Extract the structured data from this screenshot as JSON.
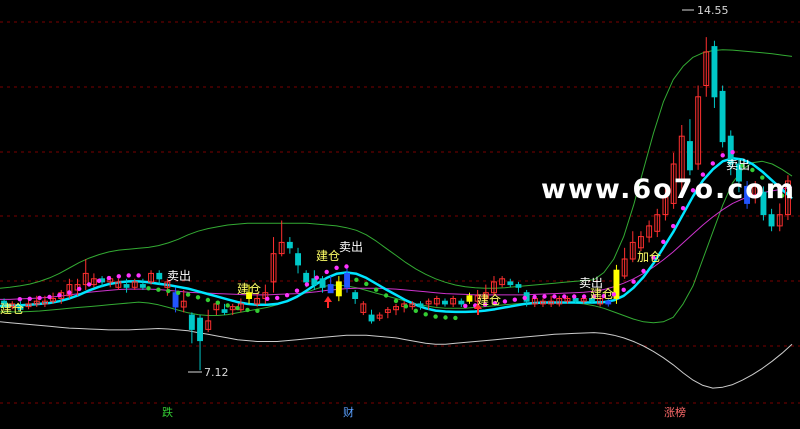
{
  "chart_data": {
    "type": "candlestick",
    "title": "",
    "ylim": [
      6.5,
      15.2
    ],
    "grid": true,
    "price_high_label": "14.55",
    "price_low_label": "7.12",
    "bottom_tags": [
      {
        "text": "跌",
        "color": "#33cc33"
      },
      {
        "text": "财",
        "color": "#5aa0ff"
      },
      {
        "text": "涨榜",
        "color": "#ff6a6a"
      }
    ],
    "signal_labels": [
      {
        "text": "建仓",
        "color": "#ffff66"
      },
      {
        "text": "卖出",
        "color": "#ffffff"
      },
      {
        "text": "建仓",
        "color": "#ffff66"
      },
      {
        "text": "建仓",
        "color": "#ffff66"
      },
      {
        "text": "卖出",
        "color": "#ffffff"
      },
      {
        "text": "建仓",
        "color": "#ffff66"
      },
      {
        "text": "卖出",
        "color": "#ffffff"
      },
      {
        "text": "建仓",
        "color": "#ffff66"
      },
      {
        "text": "加仓",
        "color": "#ffff66"
      },
      {
        "text": "卖出",
        "color": "#ffffff"
      }
    ],
    "watermark": "www.6o7o.com",
    "colors": {
      "up": "#ff3030",
      "down": "#00c8c8",
      "flat": "#ffffff",
      "highlight_up": "#ffff00",
      "highlight_down": "#2255ff",
      "main_line": "#00e5ff",
      "envelope": "#33aa33",
      "lower_band": "#cccccc",
      "ma_line": "#cc33cc",
      "dot_hold": "#ff33ff",
      "dot_wait": "#33cc33"
    },
    "candles": [
      {
        "o": 8.66,
        "c": 8.6,
        "h": 8.72,
        "l": 8.53
      },
      {
        "o": 8.54,
        "c": 8.6,
        "h": 8.66,
        "l": 8.48
      },
      {
        "o": 8.54,
        "c": 8.48,
        "h": 8.66,
        "l": 8.42
      },
      {
        "o": 8.54,
        "c": 8.6,
        "h": 8.72,
        "l": 8.48
      },
      {
        "o": 8.6,
        "c": 8.66,
        "h": 8.78,
        "l": 8.53
      },
      {
        "o": 8.6,
        "c": 8.66,
        "h": 8.78,
        "l": 8.53
      },
      {
        "o": 8.66,
        "c": 8.72,
        "h": 8.85,
        "l": 8.6
      },
      {
        "o": 8.72,
        "c": 8.85,
        "h": 8.91,
        "l": 8.6
      },
      {
        "o": 8.78,
        "c": 9.03,
        "h": 9.16,
        "l": 8.72
      },
      {
        "o": 8.91,
        "c": 9.03,
        "h": 9.16,
        "l": 8.78
      },
      {
        "o": 9.03,
        "c": 9.28,
        "h": 9.6,
        "l": 8.91
      },
      {
        "o": 9.03,
        "c": 9.16,
        "h": 9.28,
        "l": 8.97
      },
      {
        "o": 9.16,
        "c": 9.09,
        "h": 9.22,
        "l": 8.97
      },
      {
        "o": 9.09,
        "c": 9.16,
        "h": 9.22,
        "l": 8.97
      },
      {
        "o": 8.97,
        "c": 9.09,
        "h": 9.16,
        "l": 8.91
      },
      {
        "o": 9.03,
        "c": 8.97,
        "h": 9.16,
        "l": 8.85
      },
      {
        "o": 8.97,
        "c": 9.09,
        "h": 9.16,
        "l": 8.91
      },
      {
        "o": 9.03,
        "c": 8.97,
        "h": 9.16,
        "l": 8.91
      },
      {
        "o": 9.09,
        "c": 9.28,
        "h": 9.35,
        "l": 9.03
      },
      {
        "o": 9.28,
        "c": 9.16,
        "h": 9.35,
        "l": 9.03
      },
      {
        "o": 8.97,
        "c": 9.09,
        "h": 9.16,
        "l": 8.78
      },
      {
        "o": 8.85,
        "c": 8.53,
        "h": 8.97,
        "l": 8.41,
        "hl": "down"
      },
      {
        "o": 8.53,
        "c": 8.66,
        "h": 8.91,
        "l": 8.41
      },
      {
        "o": 8.35,
        "c": 8.03,
        "h": 8.41,
        "l": 7.72
      },
      {
        "o": 8.28,
        "c": 7.78,
        "h": 8.35,
        "l": 7.12
      },
      {
        "o": 8.03,
        "c": 8.22,
        "h": 8.47,
        "l": 7.97
      },
      {
        "o": 8.47,
        "c": 8.6,
        "h": 8.66,
        "l": 8.35
      },
      {
        "o": 8.47,
        "c": 8.41,
        "h": 8.6,
        "l": 8.35
      },
      {
        "o": 8.47,
        "c": 8.54,
        "h": 8.6,
        "l": 8.35
      },
      {
        "o": 8.47,
        "c": 8.6,
        "h": 8.72,
        "l": 8.41
      },
      {
        "o": 8.85,
        "c": 8.72,
        "h": 9.03,
        "l": 8.6,
        "hl": "up"
      },
      {
        "o": 8.6,
        "c": 8.72,
        "h": 8.85,
        "l": 8.54
      },
      {
        "o": 8.72,
        "c": 8.85,
        "h": 9.03,
        "l": 8.6
      },
      {
        "o": 9.09,
        "c": 9.72,
        "h": 10.09,
        "l": 8.85
      },
      {
        "o": 9.72,
        "c": 9.97,
        "h": 10.46,
        "l": 9.66
      },
      {
        "o": 9.97,
        "c": 9.85,
        "h": 10.09,
        "l": 9.72
      },
      {
        "o": 9.72,
        "c": 9.47,
        "h": 9.85,
        "l": 9.28
      },
      {
        "o": 9.28,
        "c": 9.09,
        "h": 9.35,
        "l": 8.97
      },
      {
        "o": 9.16,
        "c": 9.03,
        "h": 9.35,
        "l": 8.91
      },
      {
        "o": 9.16,
        "c": 8.97,
        "h": 9.22,
        "l": 8.85
      },
      {
        "o": 9.03,
        "c": 8.85,
        "h": 9.22,
        "l": 8.85,
        "hl": "down"
      },
      {
        "o": 8.78,
        "c": 9.09,
        "h": 9.22,
        "l": 8.66,
        "hl": "up"
      },
      {
        "o": 8.97,
        "c": 9.28,
        "h": 9.41,
        "l": 8.85,
        "hl": "down"
      },
      {
        "o": 8.85,
        "c": 8.72,
        "h": 8.91,
        "l": 8.6
      },
      {
        "o": 8.41,
        "c": 8.6,
        "h": 8.66,
        "l": 8.35
      },
      {
        "o": 8.35,
        "c": 8.22,
        "h": 8.47,
        "l": 8.16
      },
      {
        "o": 8.28,
        "c": 8.35,
        "h": 8.41,
        "l": 8.22
      },
      {
        "o": 8.41,
        "c": 8.47,
        "h": 8.53,
        "l": 8.28
      },
      {
        "o": 8.47,
        "c": 8.54,
        "h": 8.6,
        "l": 8.35
      },
      {
        "o": 8.54,
        "c": 8.6,
        "h": 8.66,
        "l": 8.41
      },
      {
        "o": 8.54,
        "c": 8.6,
        "h": 8.66,
        "l": 8.47
      },
      {
        "o": 8.6,
        "c": 8.54,
        "h": 8.66,
        "l": 8.47
      },
      {
        "o": 8.6,
        "c": 8.66,
        "h": 8.72,
        "l": 8.47
      },
      {
        "o": 8.6,
        "c": 8.72,
        "h": 8.78,
        "l": 8.54
      },
      {
        "o": 8.66,
        "c": 8.6,
        "h": 8.72,
        "l": 8.54
      },
      {
        "o": 8.6,
        "c": 8.72,
        "h": 8.78,
        "l": 8.53
      },
      {
        "o": 8.66,
        "c": 8.6,
        "h": 8.72,
        "l": 8.53
      },
      {
        "o": 8.66,
        "c": 8.78,
        "h": 8.85,
        "l": 8.6,
        "hl": "up"
      },
      {
        "o": 8.66,
        "c": 8.78,
        "h": 8.91,
        "l": 8.6
      },
      {
        "o": 8.72,
        "c": 8.85,
        "h": 9.03,
        "l": 8.66
      },
      {
        "o": 8.85,
        "c": 9.09,
        "h": 9.22,
        "l": 8.78
      },
      {
        "o": 9.03,
        "c": 9.16,
        "h": 9.22,
        "l": 8.97
      },
      {
        "o": 9.09,
        "c": 9.03,
        "h": 9.16,
        "l": 8.97
      },
      {
        "o": 9.03,
        "c": 8.97,
        "h": 9.09,
        "l": 8.85
      },
      {
        "o": 8.85,
        "c": 8.66,
        "h": 8.91,
        "l": 8.54
      },
      {
        "o": 8.6,
        "c": 8.72,
        "h": 8.78,
        "l": 8.53
      },
      {
        "o": 8.6,
        "c": 8.66,
        "h": 8.72,
        "l": 8.53
      },
      {
        "o": 8.6,
        "c": 8.66,
        "h": 8.78,
        "l": 8.53
      },
      {
        "o": 8.6,
        "c": 8.72,
        "h": 8.78,
        "l": 8.54
      },
      {
        "o": 8.66,
        "c": 8.72,
        "h": 8.78,
        "l": 8.6
      },
      {
        "o": 8.72,
        "c": 8.66,
        "h": 8.78,
        "l": 8.6
      },
      {
        "o": 8.66,
        "c": 8.72,
        "h": 8.78,
        "l": 8.6
      },
      {
        "o": 8.72,
        "c": 8.66,
        "h": 8.78,
        "l": 8.6
      },
      {
        "o": 8.6,
        "c": 8.72,
        "h": 8.78,
        "l": 8.54
      },
      {
        "o": 8.66,
        "c": 8.6,
        "h": 8.72,
        "l": 8.54,
        "hl": "down"
      },
      {
        "o": 8.72,
        "c": 9.35,
        "h": 9.47,
        "l": 8.6,
        "hl": "up"
      },
      {
        "o": 9.22,
        "c": 9.6,
        "h": 9.85,
        "l": 9.16
      },
      {
        "o": 9.6,
        "c": 9.97,
        "h": 10.22,
        "l": 9.53
      },
      {
        "o": 9.85,
        "c": 10.1,
        "h": 10.22,
        "l": 9.78
      },
      {
        "o": 10.09,
        "c": 10.34,
        "h": 10.46,
        "l": 9.97
      },
      {
        "o": 10.22,
        "c": 10.59,
        "h": 10.72,
        "l": 10.09
      },
      {
        "o": 10.59,
        "c": 10.97,
        "h": 11.22,
        "l": 10.46
      },
      {
        "o": 10.84,
        "c": 11.72,
        "h": 11.97,
        "l": 10.72
      },
      {
        "o": 11.34,
        "c": 12.34,
        "h": 12.59,
        "l": 11.09
      },
      {
        "o": 12.22,
        "c": 11.59,
        "h": 12.72,
        "l": 11.47
      },
      {
        "o": 11.72,
        "c": 13.22,
        "h": 13.47,
        "l": 11.59
      },
      {
        "o": 13.47,
        "c": 14.22,
        "h": 14.55,
        "l": 13.22
      },
      {
        "o": 14.34,
        "c": 13.22,
        "h": 14.47,
        "l": 12.97
      },
      {
        "o": 13.34,
        "c": 12.22,
        "h": 13.47,
        "l": 12.09
      },
      {
        "o": 12.34,
        "c": 11.72,
        "h": 12.47,
        "l": 11.47
      },
      {
        "o": 11.72,
        "c": 11.34,
        "h": 11.84,
        "l": 11.09
      },
      {
        "o": 11.22,
        "c": 10.84,
        "h": 11.34,
        "l": 10.72,
        "hl": "down"
      },
      {
        "o": 10.97,
        "c": 11.22,
        "h": 11.34,
        "l": 10.84
      },
      {
        "o": 11.09,
        "c": 10.59,
        "h": 11.22,
        "l": 10.46
      },
      {
        "o": 10.59,
        "c": 10.34,
        "h": 10.72,
        "l": 10.22
      },
      {
        "o": 10.34,
        "c": 10.59,
        "h": 10.84,
        "l": 10.22
      },
      {
        "o": 10.59,
        "c": 11.34,
        "h": 11.47,
        "l": 10.47
      }
    ],
    "main_line": [
      8.55,
      8.56,
      8.57,
      8.58,
      8.6,
      8.62,
      8.66,
      8.72,
      8.8,
      8.9,
      8.98,
      9.04,
      9.08,
      9.1,
      9.1,
      9.08,
      9.05,
      9.02,
      8.98,
      8.94,
      8.88,
      8.82,
      8.76,
      8.7,
      8.64,
      8.6,
      8.58,
      8.58,
      8.6,
      8.66,
      8.76,
      8.9,
      9.05,
      9.18,
      9.27,
      9.3,
      9.27,
      9.18,
      9.05,
      8.92,
      8.8,
      8.68,
      8.58,
      8.5,
      8.45,
      8.43,
      8.42,
      8.42,
      8.43,
      8.45,
      8.48,
      8.52,
      8.56,
      8.6,
      8.62,
      8.63,
      8.63,
      8.63,
      8.63,
      8.63,
      8.63,
      8.64,
      8.68,
      8.78,
      8.96,
      9.2,
      9.5,
      9.85,
      10.2,
      10.6,
      11.0,
      11.35,
      11.6,
      11.78,
      11.85,
      11.82,
      11.72,
      11.55,
      11.35,
      11.15,
      10.95
    ],
    "ma_line": [
      8.7,
      8.7,
      8.71,
      8.72,
      8.73,
      8.75,
      8.77,
      8.8,
      8.83,
      8.86,
      8.88,
      8.9,
      8.92,
      8.93,
      8.93,
      8.93,
      8.92,
      8.9,
      8.88,
      8.86,
      8.85,
      8.84,
      8.83,
      8.82,
      8.81,
      8.8,
      8.8,
      8.8,
      8.81,
      8.82,
      8.83,
      8.85,
      8.87,
      8.9,
      8.92,
      8.94,
      8.95,
      8.95,
      8.95,
      8.94,
      8.93,
      8.91,
      8.89,
      8.87,
      8.85,
      8.83,
      8.82,
      8.81,
      8.8,
      8.8,
      8.8,
      8.8,
      8.8,
      8.8,
      8.81,
      8.82,
      8.83,
      8.84,
      8.85,
      8.86,
      8.88,
      8.92,
      8.98,
      9.06,
      9.16,
      9.28,
      9.42,
      9.58,
      9.76,
      9.96,
      10.16,
      10.36,
      10.54,
      10.7,
      10.84,
      10.94,
      11.02,
      11.08,
      11.12,
      11.16,
      11.2
    ],
    "upper_band": [
      8.95,
      8.97,
      9.0,
      9.04,
      9.1,
      9.18,
      9.28,
      9.4,
      9.52,
      9.62,
      9.7,
      9.76,
      9.8,
      9.82,
      9.84,
      9.86,
      9.9,
      9.96,
      10.04,
      10.14,
      10.22,
      10.28,
      10.32,
      10.36,
      10.38,
      10.4,
      10.4,
      10.4,
      10.4,
      10.4,
      10.4,
      10.4,
      10.38,
      10.36,
      10.34,
      10.3,
      10.24,
      10.14,
      10.0,
      9.84,
      9.68,
      9.52,
      9.38,
      9.26,
      9.16,
      9.08,
      9.02,
      8.98,
      8.96,
      8.95,
      8.95,
      8.96,
      8.98,
      9.0,
      9.02,
      9.04,
      9.06,
      9.08,
      9.1,
      9.12,
      9.14,
      9.3,
      9.6,
      10.1,
      10.8,
      11.6,
      12.4,
      13.1,
      13.6,
      13.9,
      14.1,
      14.2,
      14.25,
      14.27,
      14.26,
      14.24,
      14.22,
      14.2,
      14.18,
      14.15,
      14.12
    ],
    "lower_band": [
      8.2,
      8.18,
      8.16,
      8.14,
      8.12,
      8.1,
      8.08,
      8.06,
      8.05,
      8.04,
      8.03,
      8.02,
      8.02,
      8.02,
      8.03,
      8.04,
      8.05,
      8.04,
      8.02,
      8.0,
      7.96,
      7.92,
      7.88,
      7.84,
      7.8,
      7.78,
      7.76,
      7.76,
      7.76,
      7.78,
      7.8,
      7.82,
      7.84,
      7.86,
      7.88,
      7.9,
      7.9,
      7.9,
      7.88,
      7.86,
      7.84,
      7.8,
      7.76,
      7.72,
      7.7,
      7.7,
      7.72,
      7.74,
      7.76,
      7.78,
      7.8,
      7.82,
      7.84,
      7.86,
      7.88,
      7.9,
      7.92,
      7.93,
      7.94,
      7.95,
      7.96,
      7.94,
      7.9,
      7.84,
      7.76,
      7.66,
      7.54,
      7.4,
      7.24,
      7.06,
      6.9,
      6.78,
      6.72,
      6.74,
      6.8,
      6.9,
      7.02,
      7.16,
      7.32,
      7.5,
      7.7
    ],
    "inner_band": [
      8.42,
      8.42,
      8.42,
      8.43,
      8.44,
      8.46,
      8.48,
      8.5,
      8.52,
      8.54,
      8.56,
      8.58,
      8.6,
      8.62,
      8.64,
      8.62,
      8.58,
      8.52,
      8.46,
      8.4,
      8.36,
      8.34,
      8.34,
      8.36,
      8.4,
      8.44,
      8.48,
      8.52,
      8.58,
      8.66,
      8.76,
      8.86,
      8.94,
      9.0,
      9.02,
      9.0,
      8.96,
      8.9,
      8.84,
      8.78,
      8.72,
      8.66,
      8.6,
      8.56,
      8.52,
      8.5,
      8.5,
      8.5,
      8.52,
      8.54,
      8.56,
      8.58,
      8.6,
      8.61,
      8.62,
      8.62,
      8.62,
      8.62,
      8.62,
      8.6,
      8.56,
      8.5,
      8.42,
      8.34,
      8.26,
      8.2,
      8.18,
      8.2,
      8.3,
      8.6,
      9.0,
      9.6,
      10.2,
      10.8,
      11.3,
      11.6,
      11.75,
      11.78,
      11.72,
      11.6,
      11.45
    ]
  }
}
